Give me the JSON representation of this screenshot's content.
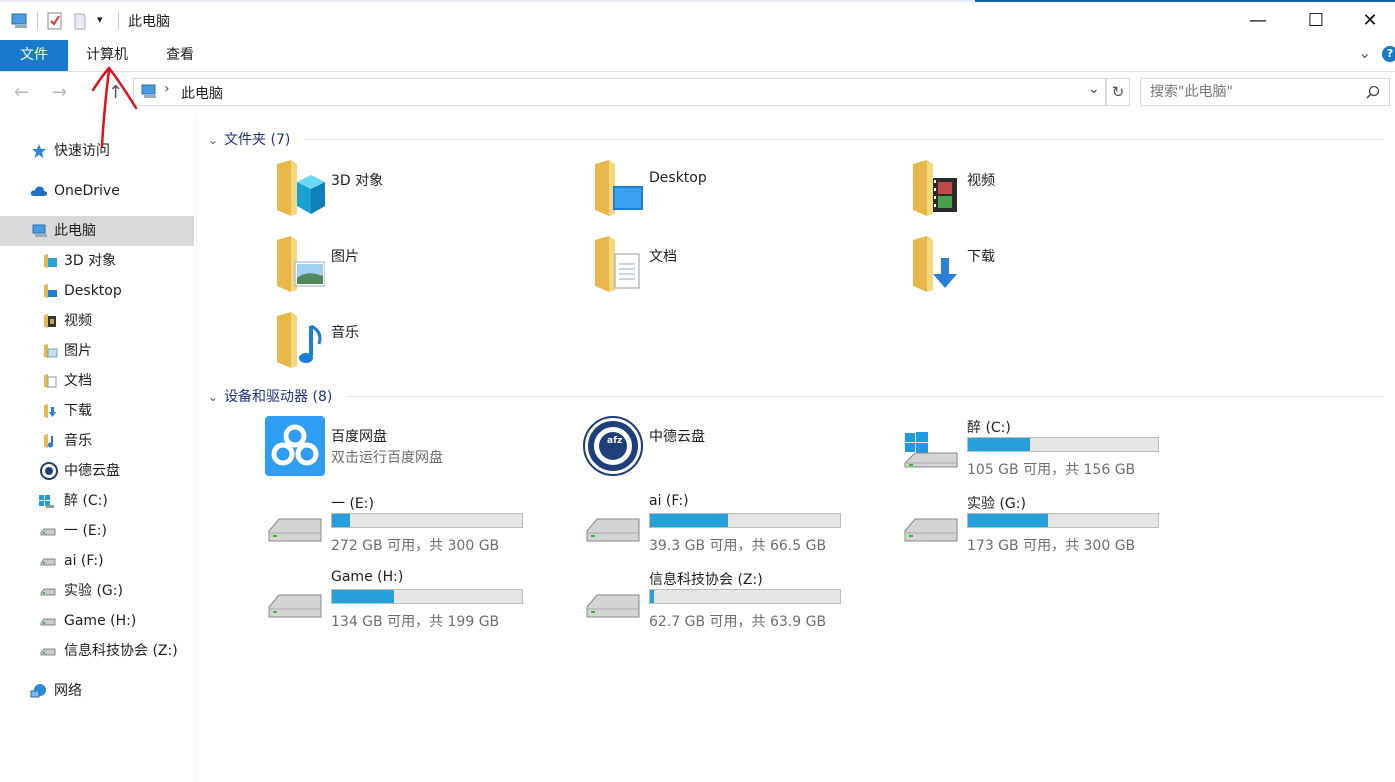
{
  "window": {
    "title": "此电脑",
    "minimize": "—",
    "maximize": "☐",
    "close": "✕"
  },
  "ribbon": {
    "tabs": [
      "文件",
      "计算机",
      "查看"
    ],
    "help": "?",
    "expand": "⌄"
  },
  "nav": {
    "back": "←",
    "forward": "→",
    "up": "↑",
    "path_sep": "›",
    "path": "此电脑",
    "refresh": "↻",
    "dropdown": "⌄"
  },
  "search": {
    "placeholder": "搜索\"此电脑\""
  },
  "sidebar": {
    "items": [
      {
        "label": "快速访问",
        "icon": "star-icon"
      },
      {
        "label": "OneDrive",
        "icon": "cloud-icon"
      },
      {
        "label": "此电脑",
        "icon": "computer-icon",
        "selected": true
      },
      {
        "label": "3D 对象",
        "icon": "folder-3d-icon"
      },
      {
        "label": "Desktop",
        "icon": "folder-desktop-icon"
      },
      {
        "label": "视频",
        "icon": "folder-video-icon"
      },
      {
        "label": "图片",
        "icon": "folder-pictures-icon"
      },
      {
        "label": "文档",
        "icon": "folder-documents-icon"
      },
      {
        "label": "下载",
        "icon": "folder-downloads-icon"
      },
      {
        "label": "音乐",
        "icon": "folder-music-icon"
      },
      {
        "label": "中德云盘",
        "icon": "cloud-disk-icon"
      },
      {
        "label": "醉 (C:)",
        "icon": "windows-drive-icon"
      },
      {
        "label": "一 (E:)",
        "icon": "drive-icon"
      },
      {
        "label": "ai (F:)",
        "icon": "drive-icon"
      },
      {
        "label": "实验 (G:)",
        "icon": "drive-icon"
      },
      {
        "label": "Game (H:)",
        "icon": "drive-icon"
      },
      {
        "label": "信息科技协会 (Z:)",
        "icon": "network-drive-icon"
      },
      {
        "label": "网络",
        "icon": "network-icon"
      }
    ]
  },
  "folders": {
    "header": "文件夹 (7)",
    "items": [
      {
        "name": "3D 对象",
        "icon": "folder-3d-icon"
      },
      {
        "name": "Desktop",
        "icon": "folder-desktop-icon"
      },
      {
        "name": "视频",
        "icon": "folder-video-icon"
      },
      {
        "name": "图片",
        "icon": "folder-pictures-icon"
      },
      {
        "name": "文档",
        "icon": "folder-documents-icon"
      },
      {
        "name": "下载",
        "icon": "folder-downloads-icon"
      },
      {
        "name": "音乐",
        "icon": "folder-music-icon"
      }
    ]
  },
  "devices": {
    "header": "设备和驱动器 (8)",
    "baidu": {
      "name": "百度网盘",
      "subtitle": "双击运行百度网盘"
    },
    "zhongde": {
      "name": "中德云盘",
      "logo_text": "afz"
    },
    "drives": [
      {
        "name": "醉 (C:)",
        "size": "105 GB 可用，共 156 GB",
        "used_fraction": 0.327
      },
      {
        "name": "一 (E:)",
        "size": "272 GB 可用，共 300 GB",
        "used_fraction": 0.093
      },
      {
        "name": "ai (F:)",
        "size": "39.3 GB 可用，共 66.5 GB",
        "used_fraction": 0.409
      },
      {
        "name": "实验 (G:)",
        "size": "173 GB 可用，共 300 GB",
        "used_fraction": 0.423
      },
      {
        "name": "Game (H:)",
        "size": "134 GB 可用，共 199 GB",
        "used_fraction": 0.327
      },
      {
        "name": "信息科技协会 (Z:)",
        "size": "62.7 GB 可用，共 63.9 GB",
        "used_fraction": 0.019
      }
    ]
  },
  "colors": {
    "accent": "#1979ca",
    "bar_fill": "#26a0da",
    "group_header": "#1e3287",
    "annotation": "#e3101a"
  }
}
